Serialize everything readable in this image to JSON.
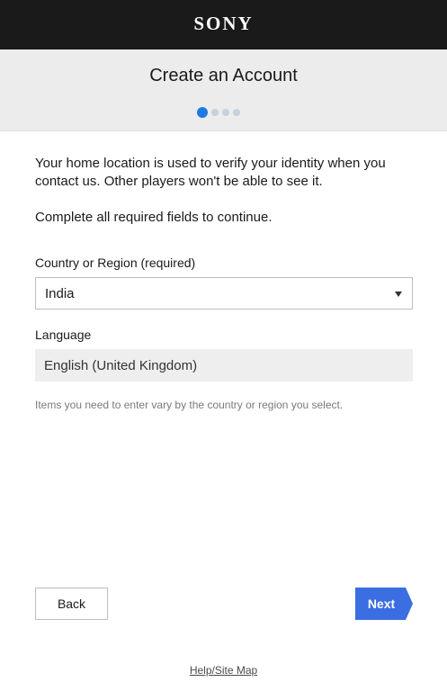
{
  "brand": {
    "logo_text": "SONY"
  },
  "header": {
    "title": "Create an Account",
    "steps": {
      "total": 4,
      "current": 1
    }
  },
  "content": {
    "intro": "Your home location is used to verify your identity when you contact us. Other players won't be able to see it.",
    "required_note": "Complete all required fields to continue.",
    "country": {
      "label": "Country or Region (required)",
      "value": "India"
    },
    "language": {
      "label": "Language",
      "value": "English (United Kingdom)"
    },
    "hint": "Items you need to enter vary by the country or region you select."
  },
  "actions": {
    "back_label": "Back",
    "next_label": "Next"
  },
  "footer": {
    "help_link": "Help/Site Map"
  },
  "colors": {
    "accent": "#3b6ee0",
    "active_step": "#1f7ae0",
    "topbar": "#1a1a1a"
  }
}
